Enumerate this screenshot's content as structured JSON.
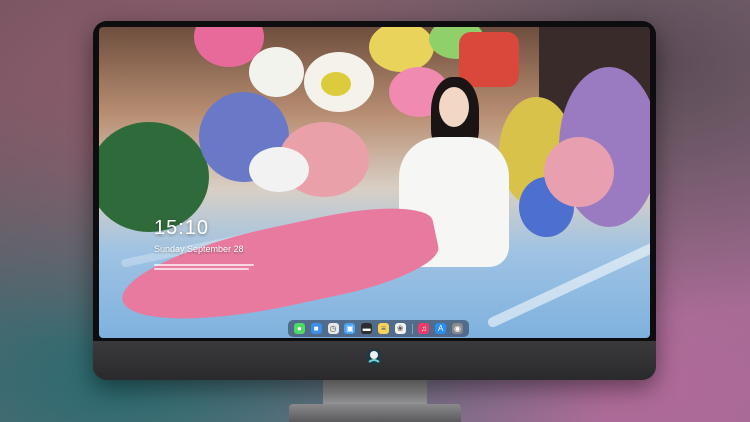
{
  "lock_screen": {
    "time": "15:10",
    "date": "Sunday September 28"
  },
  "dock": {
    "icons": [
      {
        "name": "messages-icon",
        "color": "#4cd964"
      },
      {
        "name": "finder-icon",
        "color": "#3b8fe6"
      },
      {
        "name": "clock-icon",
        "color": "#e8e8e8"
      },
      {
        "name": "apps-icon",
        "color": "#4aa3f0"
      },
      {
        "name": "clapperboard-icon",
        "color": "#2e2e2e"
      },
      {
        "name": "notes-icon",
        "color": "#f5d35a"
      },
      {
        "name": "photos-icon",
        "color": "#f0f0f0"
      },
      {
        "name": "music-icon",
        "color": "#f03a6a"
      },
      {
        "name": "app-store-icon",
        "color": "#2a8ff0"
      },
      {
        "name": "camera-icon",
        "color": "#8a8a8a"
      }
    ]
  },
  "colors": {
    "bezel": "#0d0d0f",
    "chin": "#2c2c2e"
  }
}
